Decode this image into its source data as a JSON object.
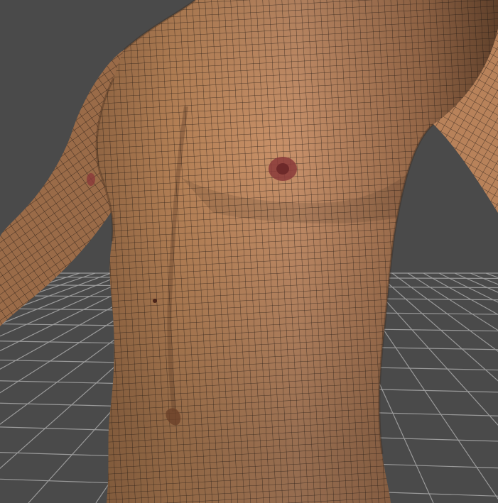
{
  "viewport": {
    "background_color": "#4a4a4a",
    "grid_line_color": "#9a9a9a",
    "grid_visible": true,
    "display_mode": "wireframe-on-shaded"
  },
  "model": {
    "subject": "male-torso",
    "skin_color": "#c48a5c",
    "skin_shadow_color": "#6e4a30",
    "wire_color": "#1a1410",
    "nipple_color": "#8a3a3a"
  }
}
